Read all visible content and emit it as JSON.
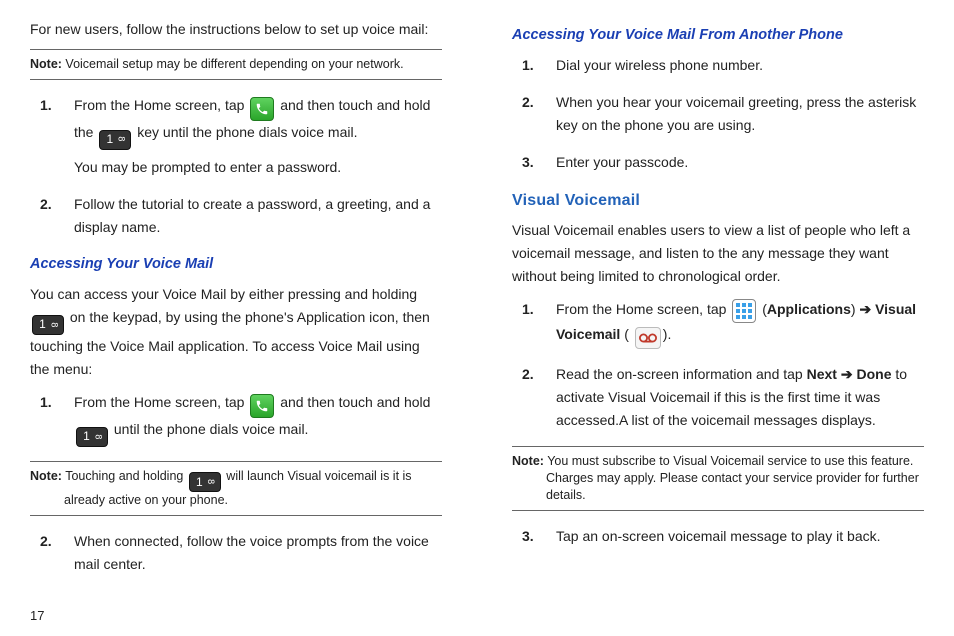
{
  "page_number": "17",
  "left": {
    "lead": "For new users, follow the instructions below to set up voice mail:",
    "note1": {
      "label": "Note:",
      "text": " Voicemail setup may be different depending on your network."
    },
    "list1": {
      "n1": "1.",
      "s1a": "From the Home screen, tap ",
      "s1b": " and then touch and hold the ",
      "s1c": " key until the phone dials voice mail.",
      "s1d": "You may be prompted to enter a password.",
      "n2": "2.",
      "s2": "Follow the tutorial to create a password, a greeting, and a display name."
    },
    "h3a": "Accessing Your Voice Mail",
    "para_a1": "You can access your Voice Mail by either pressing and holding ",
    "para_a2": " on the keypad, by using the phone's Application icon, then touching the Voice Mail application. To access Voice Mail using the menu:",
    "list2": {
      "n1": "1.",
      "s1a": "From the Home screen, tap ",
      "s1b": " and then touch and hold ",
      "s1c": " until the phone dials voice mail."
    },
    "note2": {
      "label": "Note:",
      "text": " Touching and holding ",
      "text2": " will launch Visual voicemail is it is already active on your phone."
    },
    "list3": {
      "n2": "2.",
      "s2": "When connected, follow the voice prompts from the voice mail center."
    }
  },
  "right": {
    "h3b": "Accessing Your Voice Mail From Another Phone",
    "listR1": {
      "n1": "1.",
      "s1": "Dial your wireless phone number.",
      "n2": "2.",
      "s2": "When you hear your voicemail greeting, press the asterisk key on the phone you are using.",
      "n3": "3.",
      "s3": "Enter your passcode."
    },
    "h2": "Visual Voicemail",
    "para_v": "Visual Voicemail enables users to view a list of people who left a voicemail message, and listen to the any message they want without being limited to chronological order.",
    "listR2": {
      "n1": "1.",
      "s1a": "From the Home screen, tap ",
      "s1b": " (",
      "s1c": "Applications",
      "s1d": ") ",
      "arrow": "➔",
      "s1e": " ",
      "s1f": "Visual Voicemail",
      "s1g": " (",
      "s1h": ").",
      "n2": "2.",
      "s2a": "Read the on-screen information and tap ",
      "s2b": "Next",
      "s2c": " ",
      "arrow2": "➔",
      "s2d": " ",
      "s2e": "Done",
      "s2f": " to activate Visual Voicemail if this is the first time it was accessed.A list of the voicemail messages displays."
    },
    "note3": {
      "label": "Note:",
      "text": " You must subscribe to Visual Voicemail service to use this feature. Charges may apply. Please contact your service provider for further details."
    },
    "listR3": {
      "n3": "3.",
      "s3": "Tap an on-screen voicemail message to play it back."
    }
  }
}
